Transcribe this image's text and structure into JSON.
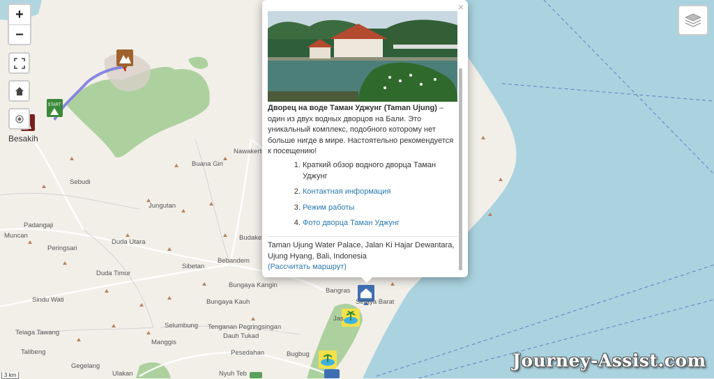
{
  "controls": {
    "zoom_in": "+",
    "zoom_out": "−"
  },
  "places": {
    "besakih": "Besakih",
    "nawakerti": "Nawakerti",
    "buana_giri": "Buana Giri",
    "sebudi": "Sebudi",
    "jungutan": "Jungutan",
    "padangaji": "Padangaji",
    "muncan": "Muncan",
    "peringsari": "Peringsari",
    "duda_utara": "Duda Utara",
    "budakeling": "Budakel",
    "sibetan": "Sibetan",
    "bebandem": "Bebandem",
    "duda_timur": "Duda Timur",
    "bungaya_kangin": "Bungaya Kangin",
    "bungaya_kauh": "Bungaya Kauh",
    "sindu_wati": "Sindu Wati",
    "bangras": "Bangras",
    "seraya_barat": "Seraya Barat",
    "selumbung": "Selumbung",
    "tenganan": "Tenganan Pegringsingan",
    "dauh_tukad": "Dauh Tukad",
    "telaga_tawang": "Telaga Tawang",
    "manggis": "Manggis",
    "pesedahan": "Pesedahan",
    "talibeng": "Talibeng",
    "bugbug": "Bugbug",
    "gegelang": "Gegelang",
    "ulakan": "Ulakan",
    "nyuh_tebel": "Nyuh Teb",
    "jas": "Jas"
  },
  "popup": {
    "close": "×",
    "title": "Дворец на воде Таман Уджунг (Taman Ujung)",
    "description": " – один из двух водных дворцов на Бали. Это уникальный комплекс, подобного которому нет больше нигде в мире. Настоятельно рекомендуется к посещению!",
    "list": [
      "Краткий обзор водного дворца Таман Уджунг",
      "Контактная информация",
      "Режим работы",
      "Фото дворца Таман Уджунг"
    ],
    "address": "Taman Ujung Water Palace, Jalan Ki Hajar Dewantara, Ujung Hyang, Bali, Indonesia",
    "route_link": "(Рассчитать маршрут)"
  },
  "scale": "3 km",
  "watermark": "Journey-Assist.com",
  "colors": {
    "sea": "#aad3df",
    "land": "#f2efe9",
    "forest": "#add19e",
    "route": "#7b7be0",
    "link": "#2a7ab0"
  },
  "icons": [
    "mountain-marker-icon",
    "start-marker-icon",
    "palace-marker-icon",
    "beach-marker-icon",
    "layers-icon",
    "home-icon",
    "fullscreen-icon",
    "locate-icon"
  ]
}
